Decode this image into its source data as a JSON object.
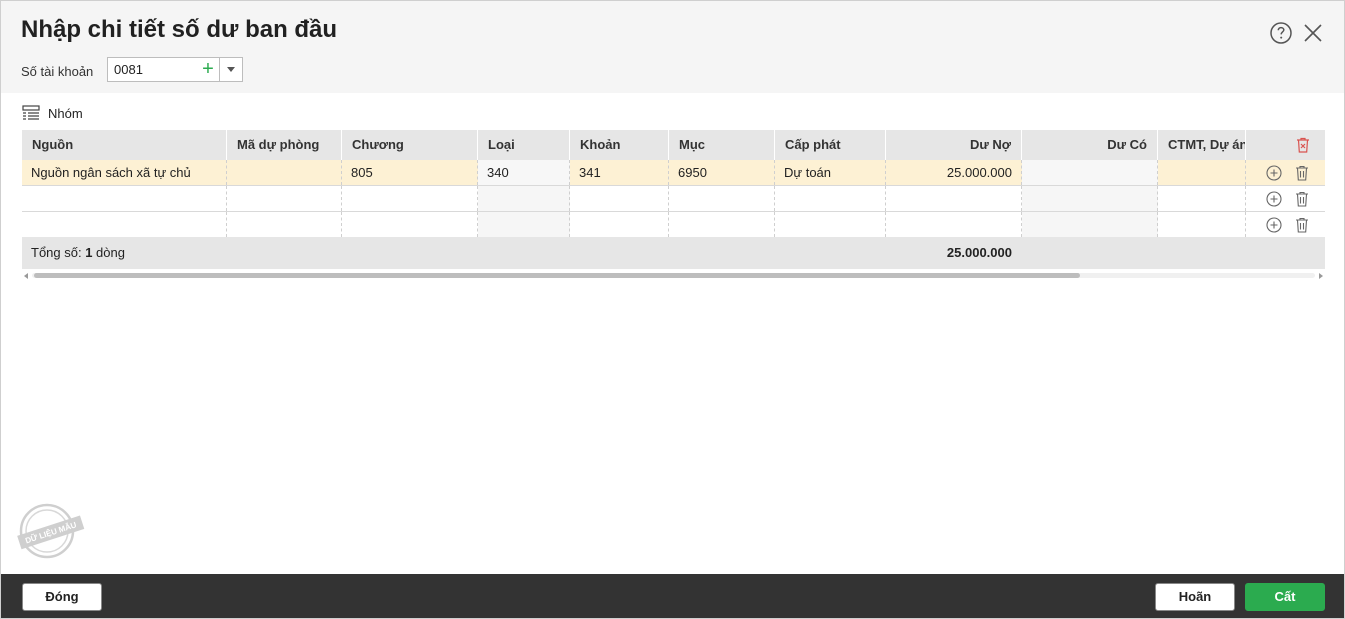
{
  "dialog": {
    "title": "Nhập chi tiết số dư ban đầu",
    "account_label": "Số tài khoản",
    "account_value": "0081",
    "help_icon": "question-circle-icon",
    "close_icon": "close-x-icon"
  },
  "toolbar": {
    "group_label": "Nhóm",
    "group_icon": "group-list-icon"
  },
  "grid": {
    "columns": [
      "Nguồn",
      "Mã dự phòng",
      "Chương",
      "Loại",
      "Khoản",
      "Mục",
      "Cấp phát",
      "Dư Nợ",
      "Dư Có",
      "CTMT, Dự án"
    ],
    "rows": [
      {
        "nguon": "Nguồn ngân sách xã tự chủ",
        "ma_du_phong": "",
        "chuong": "805",
        "loai": "340",
        "khoan": "341",
        "muc": "6950",
        "cap_phat": "Dự toán",
        "du_no": "25.000.000",
        "du_co": "",
        "ctmt": ""
      },
      {
        "nguon": "",
        "ma_du_phong": "",
        "chuong": "",
        "loai": "",
        "khoan": "",
        "muc": "",
        "cap_phat": "",
        "du_no": "",
        "du_co": "",
        "ctmt": ""
      },
      {
        "nguon": "",
        "ma_du_phong": "",
        "chuong": "",
        "loai": "",
        "khoan": "",
        "muc": "",
        "cap_phat": "",
        "du_no": "",
        "du_co": "",
        "ctmt": ""
      }
    ],
    "total_prefix": "Tổng số: ",
    "total_count": "1",
    "total_suffix": " dòng",
    "total_du_no": "25.000.000"
  },
  "stamp_text": "DỮ LIỆU MẪU",
  "footer": {
    "close_label": "Đóng",
    "cancel_label": "Hoãn",
    "save_label": "Cất"
  },
  "colors": {
    "accent_green": "#2bab4f",
    "selected_row": "#fdf1d4",
    "footer_bg": "#333333",
    "delete_red": "#d9534f"
  }
}
